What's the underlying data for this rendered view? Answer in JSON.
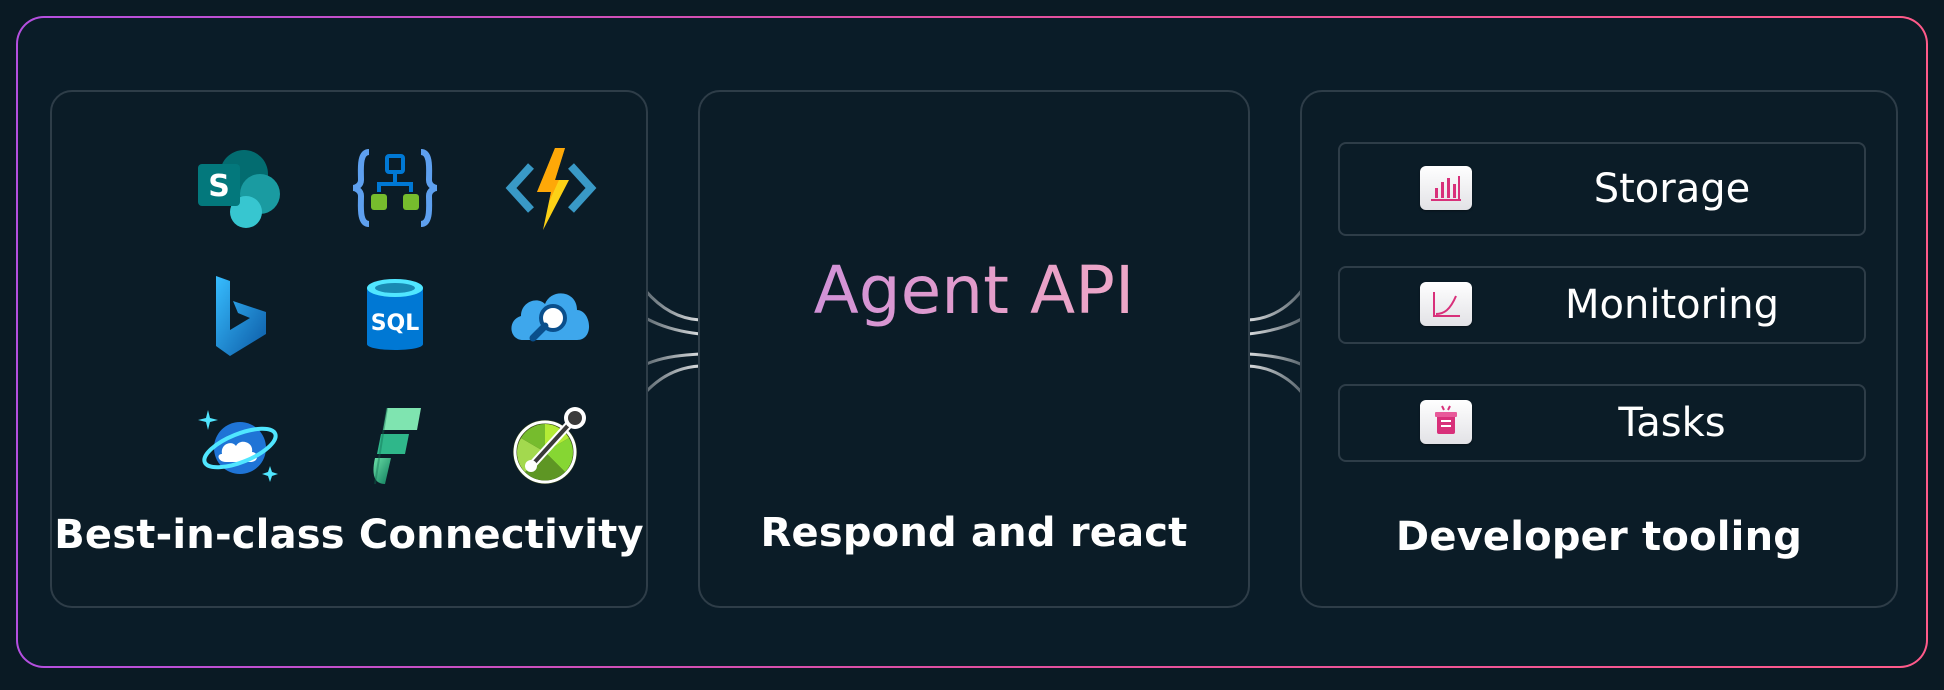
{
  "left_panel": {
    "caption": "Best-in-class Connectivity",
    "icons": [
      {
        "name": "sharepoint-icon"
      },
      {
        "name": "logic-apps-icon"
      },
      {
        "name": "azure-functions-icon"
      },
      {
        "name": "bing-icon"
      },
      {
        "name": "sql-database-icon",
        "label": "SQL"
      },
      {
        "name": "cognitive-search-icon"
      },
      {
        "name": "cosmos-db-icon"
      },
      {
        "name": "fabric-icon"
      },
      {
        "name": "api-management-icon"
      }
    ]
  },
  "middle_panel": {
    "title": "Agent API",
    "caption": "Respond and react"
  },
  "right_panel": {
    "caption": "Developer tooling",
    "tools": [
      {
        "label": "Storage",
        "icon": "storage-chart-icon"
      },
      {
        "label": "Monitoring",
        "icon": "monitoring-graph-icon"
      },
      {
        "label": "Tasks",
        "icon": "tasks-icon"
      }
    ]
  },
  "colors": {
    "background": "#0a1a24",
    "panel_border": "#2e3d48",
    "title_gradient_start": "#c58adf",
    "title_gradient_end": "#f2b0c8",
    "accent_pink": "#d8307a"
  }
}
